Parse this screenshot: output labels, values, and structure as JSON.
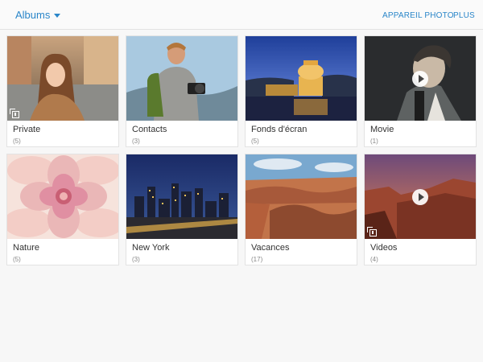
{
  "header": {
    "title": "Albums",
    "actions": {
      "camera": "APPAREIL PHOTO",
      "more": "PLUS"
    },
    "accent": "#2a86c9"
  },
  "albums": [
    {
      "name": "Private",
      "count": "(5)",
      "badge": "private-album-icon"
    },
    {
      "name": "Contacts",
      "count": "(3)"
    },
    {
      "name": "Fonds d'écran",
      "count": "(5)"
    },
    {
      "name": "Movie",
      "count": "(1)",
      "badge": "play-icon"
    },
    {
      "name": "Nature",
      "count": "(5)"
    },
    {
      "name": "New York",
      "count": "(3)"
    },
    {
      "name": "Vacances",
      "count": "(17)"
    },
    {
      "name": "Videos",
      "count": "(4)",
      "badge": "play-icon"
    }
  ]
}
